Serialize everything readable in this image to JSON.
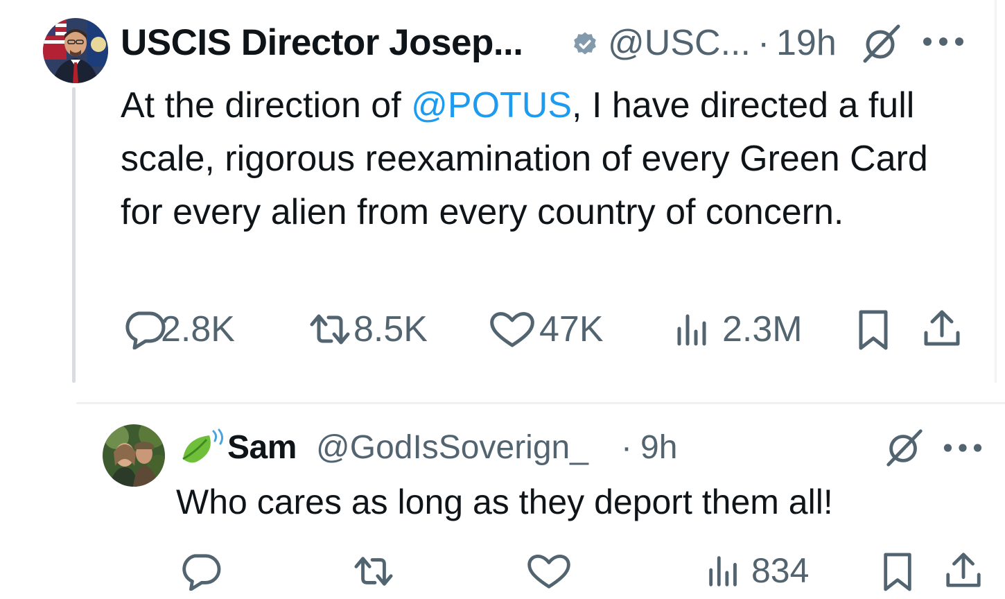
{
  "main_tweet": {
    "author_name": "USCIS Director Josep...",
    "handle": "@USC...",
    "dot": "·",
    "time": "19h",
    "text_before": "At the direction of ",
    "mention": "@POTUS",
    "text_after": ", I have directed a full scale, rigorous reexamination of every Green Card for every alien from every country of concern.",
    "stats": {
      "replies": "2.8K",
      "reposts": "8.5K",
      "likes": "47K",
      "views": "2.3M"
    }
  },
  "reply_tweet": {
    "author_name": "Sam",
    "handle": "@GodIsSoverign_",
    "dot": "·",
    "time": "9h",
    "text": "Who cares as long as they deport them all!",
    "stats": {
      "views": "834"
    }
  },
  "colors": {
    "text": "#0f1419",
    "muted": "#536471",
    "mention": "#1d9bf0"
  },
  "icons": [
    "verified-badge-icon",
    "grok-icon",
    "more-icon",
    "reply-icon",
    "repost-icon",
    "like-icon",
    "views-icon",
    "bookmark-icon",
    "share-icon",
    "leaf-emoji-icon"
  ]
}
